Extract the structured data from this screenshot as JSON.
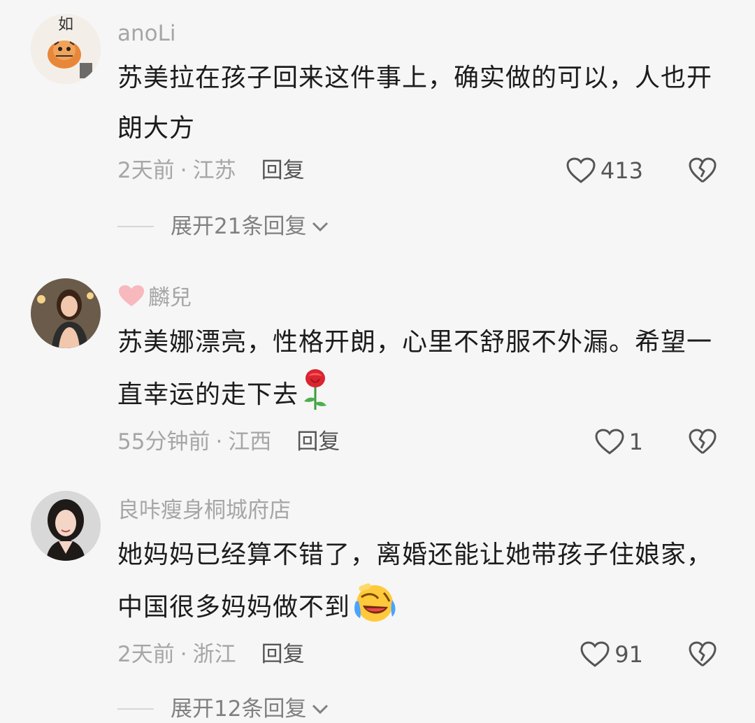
{
  "comments": [
    {
      "username": "anoLi",
      "text": "苏美拉在孩子回来这件事上，确实做的可以，人也开朗大方",
      "time": "2天前",
      "location": "江苏",
      "reply": "回复",
      "likes": "413",
      "expand": "展开21条回复",
      "avatar": "tiger-avatar"
    },
    {
      "username": "麟兒",
      "text": "苏美娜漂亮，性格开朗，心里不舒服不外漏。希望一直幸运的走下去",
      "emoji": "rose-emoji",
      "time": "55分钟前",
      "location": "江西",
      "reply": "回复",
      "likes": "1",
      "avatar": "woman-photo-avatar"
    },
    {
      "username": "良咔瘦身桐城府店",
      "text": "她妈妈已经算不错了，离婚还能让她带孩子住娘家，中国很多妈妈做不到",
      "emoji": "crying-laughing-emoji",
      "time": "2天前",
      "location": "浙江",
      "reply": "回复",
      "likes": "91",
      "expand": "展开12条回复",
      "avatar": "woman-portrait-avatar"
    }
  ],
  "colors": {
    "background": "#f6f6f6",
    "muted": "#a6a6a6",
    "text": "#1c1c1c",
    "heart": "#f7b9bd"
  }
}
